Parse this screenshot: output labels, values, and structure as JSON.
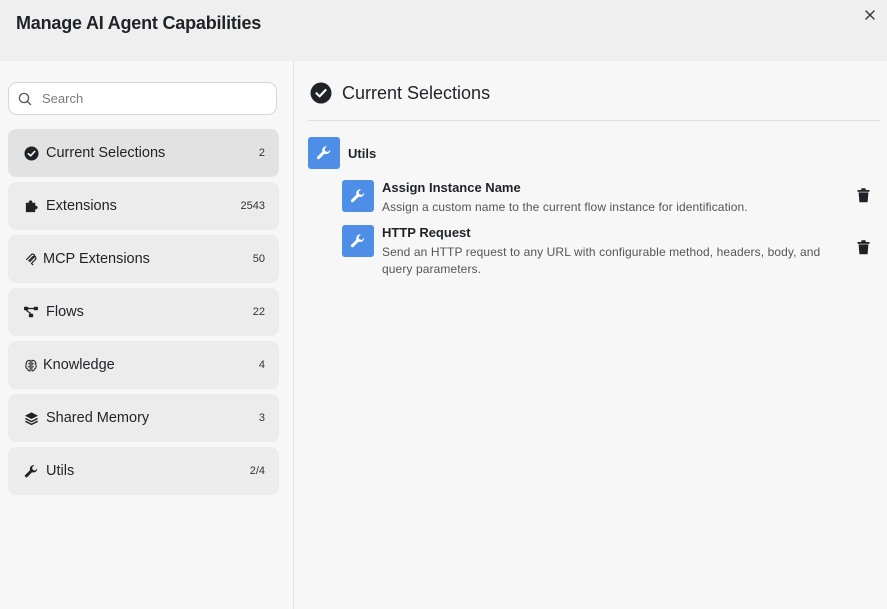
{
  "dialog": {
    "title": "Manage AI Agent Capabilities"
  },
  "search": {
    "placeholder": "Search"
  },
  "sidebar": {
    "items": [
      {
        "label": "Current Selections",
        "count": "2",
        "icon": "check-circle-icon"
      },
      {
        "label": "Extensions",
        "count": "2543",
        "icon": "puzzle-icon"
      },
      {
        "label": "MCP Extensions",
        "count": "50",
        "icon": "mcp-icon"
      },
      {
        "label": "Flows",
        "count": "22",
        "icon": "flow-icon"
      },
      {
        "label": "Knowledge",
        "count": "4",
        "icon": "brain-icon"
      },
      {
        "label": "Shared Memory",
        "count": "3",
        "icon": "layers-icon"
      },
      {
        "label": "Utils",
        "count": "2/4",
        "icon": "wrench-icon"
      }
    ]
  },
  "main": {
    "title": "Current Selections",
    "group": {
      "label": "Utils"
    },
    "tools": [
      {
        "name": "Assign Instance Name",
        "description": "Assign a custom name to the current flow instance for identification."
      },
      {
        "name": "HTTP Request",
        "description": "Send an HTTP request to any URL with configurable method, headers, body, and query parameters."
      }
    ]
  },
  "colors": {
    "accent": "#4f8ee6",
    "header_bg": "#efefef",
    "nav_bg": "#ececec",
    "nav_active_bg": "#e2e2e2"
  }
}
